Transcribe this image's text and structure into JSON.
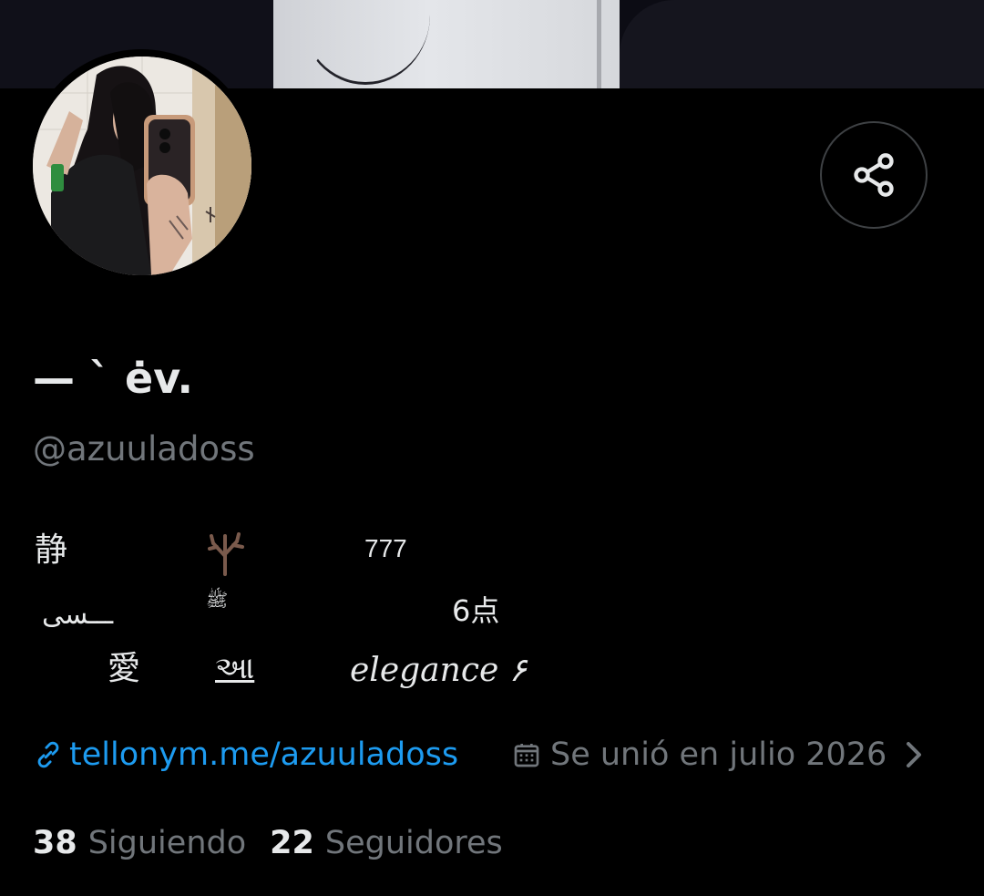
{
  "profile": {
    "display_name": "— ` ėv.",
    "handle": "@azuuladoss",
    "bio": {
      "line1": [
        "静",
        "777"
      ],
      "line2": [
        "ـــسى",
        "ﷺ",
        "6点"
      ],
      "line3": [
        "愛",
        "આ",
        "elegance ۶"
      ]
    },
    "link": "tellonym.me/azuuladoss",
    "joined": "Se unió en julio 2026",
    "following_count": "38",
    "following_label": "Siguiendo",
    "followers_count": "22",
    "followers_label": "Seguidores"
  },
  "icons": {
    "share": "share-icon",
    "link": "link-icon",
    "calendar": "calendar-icon",
    "chevron": "chevron-right-icon",
    "bio_emoji": "bare-tree-icon"
  },
  "colors": {
    "background": "#000000",
    "primary_text": "#e7e9ea",
    "secondary_text": "#71767b",
    "link": "#1d9bf0",
    "border": "#3e4144"
  }
}
